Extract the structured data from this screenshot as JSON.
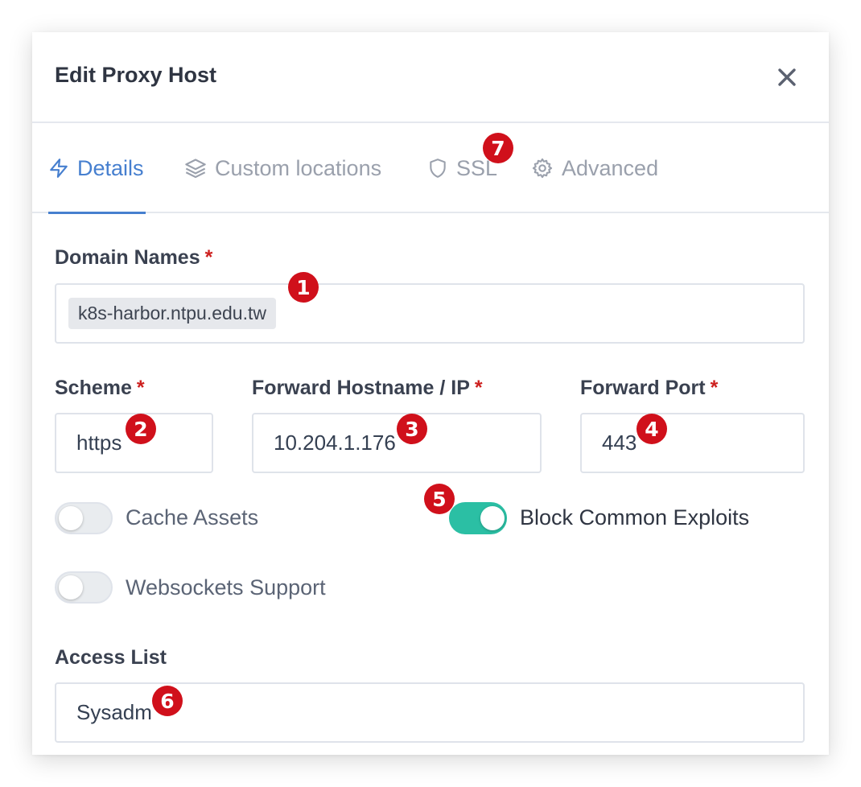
{
  "modal": {
    "title": "Edit Proxy Host"
  },
  "tabs": [
    {
      "label": "Details",
      "icon": "bolt-icon",
      "active": true
    },
    {
      "label": "Custom locations",
      "icon": "layers-icon",
      "active": false
    },
    {
      "label": "SSL",
      "icon": "shield-icon",
      "active": false
    },
    {
      "label": "Advanced",
      "icon": "gear-icon",
      "active": false
    }
  ],
  "form": {
    "domain_names": {
      "label": "Domain Names",
      "required": "*",
      "chips": [
        "k8s-harbor.ntpu.edu.tw"
      ]
    },
    "scheme": {
      "label": "Scheme",
      "required": "*",
      "value": "https"
    },
    "forward_host": {
      "label": "Forward Hostname / IP",
      "required": "*",
      "value": "10.204.1.176"
    },
    "forward_port": {
      "label": "Forward Port",
      "required": "*",
      "value": "443"
    },
    "toggles": {
      "cache_assets": {
        "label": "Cache Assets",
        "on": false
      },
      "block_exploits": {
        "label": "Block Common Exploits",
        "on": true
      },
      "websockets": {
        "label": "Websockets Support",
        "on": false
      }
    },
    "access_list": {
      "label": "Access List",
      "value": "Sysadm"
    }
  },
  "annotations": [
    "1",
    "2",
    "3",
    "4",
    "5",
    "6",
    "7"
  ],
  "colors": {
    "accent": "#467fcf",
    "toggle_on": "#2bbfa4",
    "required": "#cd201f",
    "badge": "#d0101b"
  }
}
